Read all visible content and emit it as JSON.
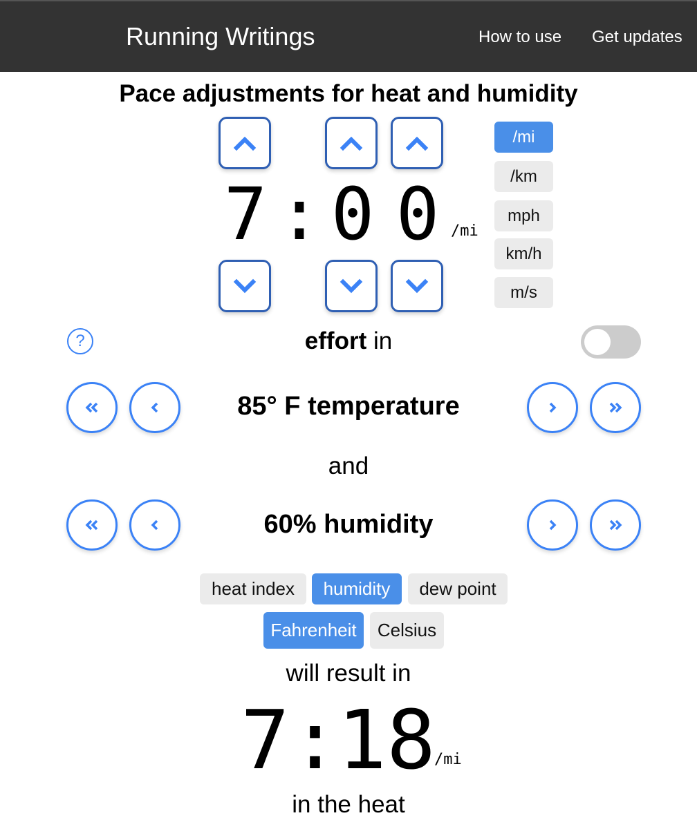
{
  "header": {
    "brand": "Running Writings",
    "nav": {
      "how_to_use": "How to use",
      "get_updates": "Get updates"
    }
  },
  "page": {
    "title": "Pace adjustments for heat and humidity"
  },
  "pace_input": {
    "minutes": "7",
    "separator": ":",
    "seconds_tens": "0",
    "seconds_ones": "0",
    "unit_suffix": "/mi"
  },
  "units": {
    "options": [
      "/mi",
      "/km",
      "mph",
      "km/h",
      "m/s"
    ],
    "selected": "/mi"
  },
  "effort": {
    "bold": "effort",
    "rest": " in",
    "help_icon": "?",
    "toggle_on": false
  },
  "temperature": {
    "label": "85° F temperature"
  },
  "connector": "and",
  "humidity": {
    "label": "60% humidity"
  },
  "measure_mode": {
    "options": [
      "heat index",
      "humidity",
      "dew point"
    ],
    "selected": "humidity"
  },
  "temp_scale": {
    "options": [
      "Fahrenheit",
      "Celsius"
    ],
    "selected": "Fahrenheit"
  },
  "result": {
    "lead": "will result in",
    "minutes": "7",
    "separator": ":",
    "seconds": "18",
    "unit_suffix": "/mi",
    "tail": "in the heat"
  },
  "icons": {
    "up": "chevron-up-icon",
    "down": "chevron-down-icon",
    "left": "chevron-left-icon",
    "right": "chevron-right-icon",
    "double_left": "double-chevron-left-icon",
    "double_right": "double-chevron-right-icon",
    "help": "question-circle-icon"
  },
  "colors": {
    "accent": "#4a8fe8",
    "button_border": "#2f5fb3",
    "round_button_border": "#3b82f6",
    "header_bg": "#333333"
  }
}
